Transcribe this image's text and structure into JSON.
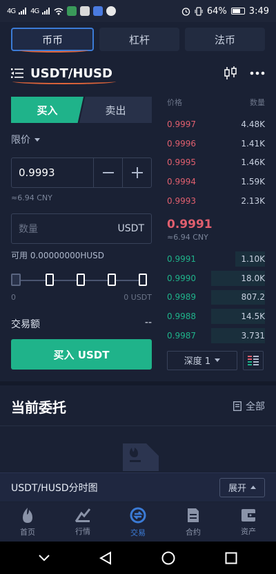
{
  "status_bar": {
    "signal1": "4G",
    "signal2": "4G",
    "battery": "64%",
    "time": "3:49"
  },
  "market_tabs": [
    {
      "label": "币币",
      "active": true
    },
    {
      "label": "杠杆",
      "active": false
    },
    {
      "label": "法币",
      "active": false
    }
  ],
  "pair": {
    "symbol": "USDT/HUSD"
  },
  "trade_panel": {
    "buy_label": "买入",
    "sell_label": "卖出",
    "order_type": "限价",
    "price_value": "0.9993",
    "price_cny": "≈6.94 CNY",
    "qty_placeholder": "数量",
    "qty_unit": "USDT",
    "available": "可用 0.00000000HUSD",
    "slider_min": "0",
    "slider_max": "0 USDT",
    "turnover_label": "交易额",
    "turnover_value": "--",
    "submit_label": "买入 USDT"
  },
  "order_book": {
    "price_header": "价格",
    "qty_header": "数量",
    "asks": [
      {
        "price": "0.9997",
        "qty": "4.48K"
      },
      {
        "price": "0.9996",
        "qty": "1.41K"
      },
      {
        "price": "0.9995",
        "qty": "1.46K"
      },
      {
        "price": "0.9994",
        "qty": "1.59K"
      },
      {
        "price": "0.9993",
        "qty": "2.13K"
      }
    ],
    "last_price": "0.9991",
    "last_cny": "≈6.94 CNY",
    "bids": [
      {
        "price": "0.9991",
        "qty": "1.10K",
        "depth": 0.3
      },
      {
        "price": "0.9990",
        "qty": "18.0K",
        "depth": 0.55
      },
      {
        "price": "0.9989",
        "qty": "807.2",
        "depth": 0.55
      },
      {
        "price": "0.9988",
        "qty": "14.5K",
        "depth": 0.55
      },
      {
        "price": "0.9987",
        "qty": "3.731",
        "depth": 0.55
      }
    ],
    "depth_label": "深度 1"
  },
  "orders": {
    "title": "当前委托",
    "all_label": "全部"
  },
  "timeshare": {
    "title": "USDT/HUSD分时图",
    "expand_label": "展开"
  },
  "bottom_nav": [
    {
      "label": "首页",
      "icon": "flame-icon",
      "active": false
    },
    {
      "label": "行情",
      "icon": "market-icon",
      "active": false
    },
    {
      "label": "交易",
      "icon": "exchange-icon",
      "active": true
    },
    {
      "label": "合约",
      "icon": "contract-icon",
      "active": false
    },
    {
      "label": "资产",
      "icon": "wallet-icon",
      "active": false
    }
  ],
  "colors": {
    "buy_green": "#1fb38a",
    "sell_red": "#e05f6e",
    "accent_blue": "#3b7bd6",
    "background": "#1a2134"
  }
}
